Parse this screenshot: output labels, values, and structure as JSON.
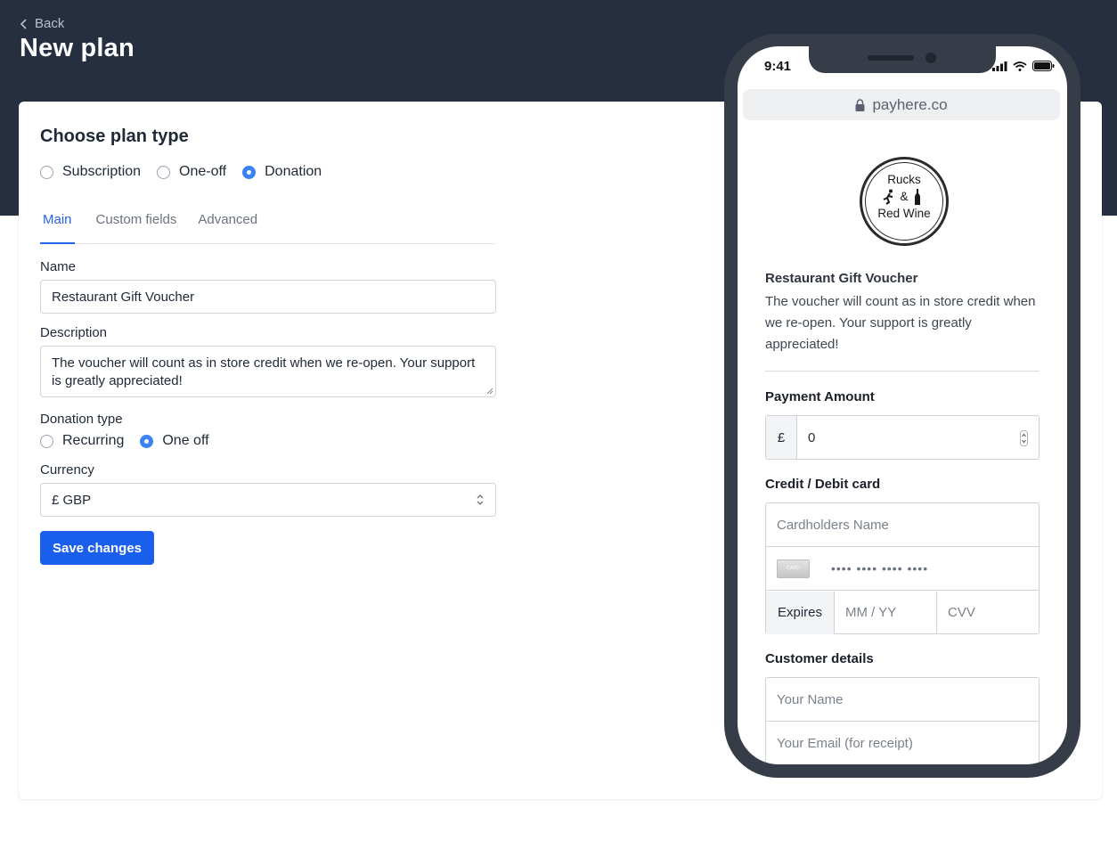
{
  "header": {
    "back_label": "Back",
    "title": "New plan"
  },
  "plan_type": {
    "title": "Choose plan type",
    "options": [
      "Subscription",
      "One-off",
      "Donation"
    ],
    "selected": "Donation"
  },
  "tabs": [
    {
      "label": "Main",
      "active": true
    },
    {
      "label": "Custom fields",
      "active": false
    },
    {
      "label": "Advanced",
      "active": false
    }
  ],
  "form": {
    "name_label": "Name",
    "name_value": "Restaurant Gift Voucher",
    "description_label": "Description",
    "description_value": "The voucher will count as in store credit when we re-open. Your support is greatly appreciated!",
    "donation_type_label": "Donation type",
    "donation_type_options": [
      "Recurring",
      "One off"
    ],
    "donation_type_selected": "One off",
    "currency_label": "Currency",
    "currency_value": "£ GBP",
    "save_label": "Save changes"
  },
  "preview": {
    "status_time": "9:41",
    "url": "payhere.co",
    "logo_lines": [
      "Rucks",
      "&",
      "Red Wine"
    ],
    "plan_title": "Restaurant Gift Voucher",
    "plan_description": "The voucher will count as in store credit when we re-open. Your support is greatly appreciated!",
    "payment_amount_label": "Payment Amount",
    "currency_symbol": "£",
    "amount_value": "0",
    "card_label": "Credit / Debit card",
    "cardholder_placeholder": "Cardholders Name",
    "card_brand_text": "CARD",
    "card_number_placeholder": "•••• •••• •••• ••••",
    "expires_label": "Expires",
    "mmyy_placeholder": "MM / YY",
    "cvv_placeholder": "CVV",
    "customer_label": "Customer details",
    "name_placeholder": "Your Name",
    "email_placeholder": "Your Email (for receipt)"
  },
  "colors": {
    "header_bg": "#262f40",
    "primary": "#1a5fec",
    "radio_checked": "#3b82f6",
    "phone_frame": "#363d48"
  }
}
